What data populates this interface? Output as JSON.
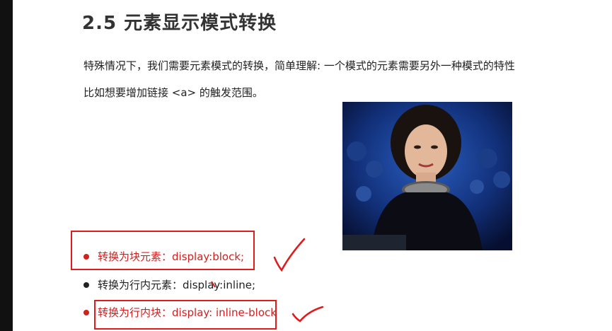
{
  "slide": {
    "title": "2.5 元素显示模式转换",
    "paragraph1": "特殊情况下，我们需要元素模式的转换，简单理解: 一个模式的元素需要另外一种模式的特性",
    "paragraph2": "比如想要增加链接 <a> 的触发范围。"
  },
  "list": [
    {
      "text": "转换为块元素：display:block;",
      "color": "#d12020"
    },
    {
      "text": "转换为行内元素：display:inline;",
      "color": "#222222"
    },
    {
      "text": "转换为行内块：display: inline-block",
      "color": "#d12020"
    }
  ],
  "photo": {
    "subject": "woman-portrait"
  },
  "annotation_color": "#e01b1b"
}
